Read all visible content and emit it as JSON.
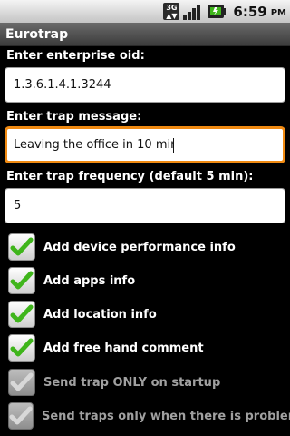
{
  "status_bar": {
    "network_label": "3G",
    "time": "6:59",
    "ampm": "PM",
    "icons": [
      "3g-icon",
      "signal-icon",
      "battery-icon"
    ]
  },
  "app": {
    "title": "Eurotrap"
  },
  "form": {
    "oid_label": "Enter enterprise oid:",
    "oid_value": "1.3.6.1.4.1.3244",
    "message_label": "Enter trap message:",
    "message_value": "Leaving the office in 10 min",
    "frequency_label": "Enter trap frequency (default 5 min):",
    "frequency_value": "5"
  },
  "options": [
    {
      "label": "Add device performance info",
      "checked": true,
      "enabled": true
    },
    {
      "label": "Add apps info",
      "checked": true,
      "enabled": true
    },
    {
      "label": "Add location info",
      "checked": true,
      "enabled": true
    },
    {
      "label": "Add free hand comment",
      "checked": true,
      "enabled": true
    },
    {
      "label": "Send trap ONLY on startup",
      "checked": true,
      "enabled": false
    },
    {
      "label": "Send traps only when there is problem",
      "checked": true,
      "enabled": false
    }
  ],
  "colors": {
    "focus_border": "#f08a12",
    "check_enabled": "#3fb51b",
    "check_disabled": "#d8d8d8"
  }
}
